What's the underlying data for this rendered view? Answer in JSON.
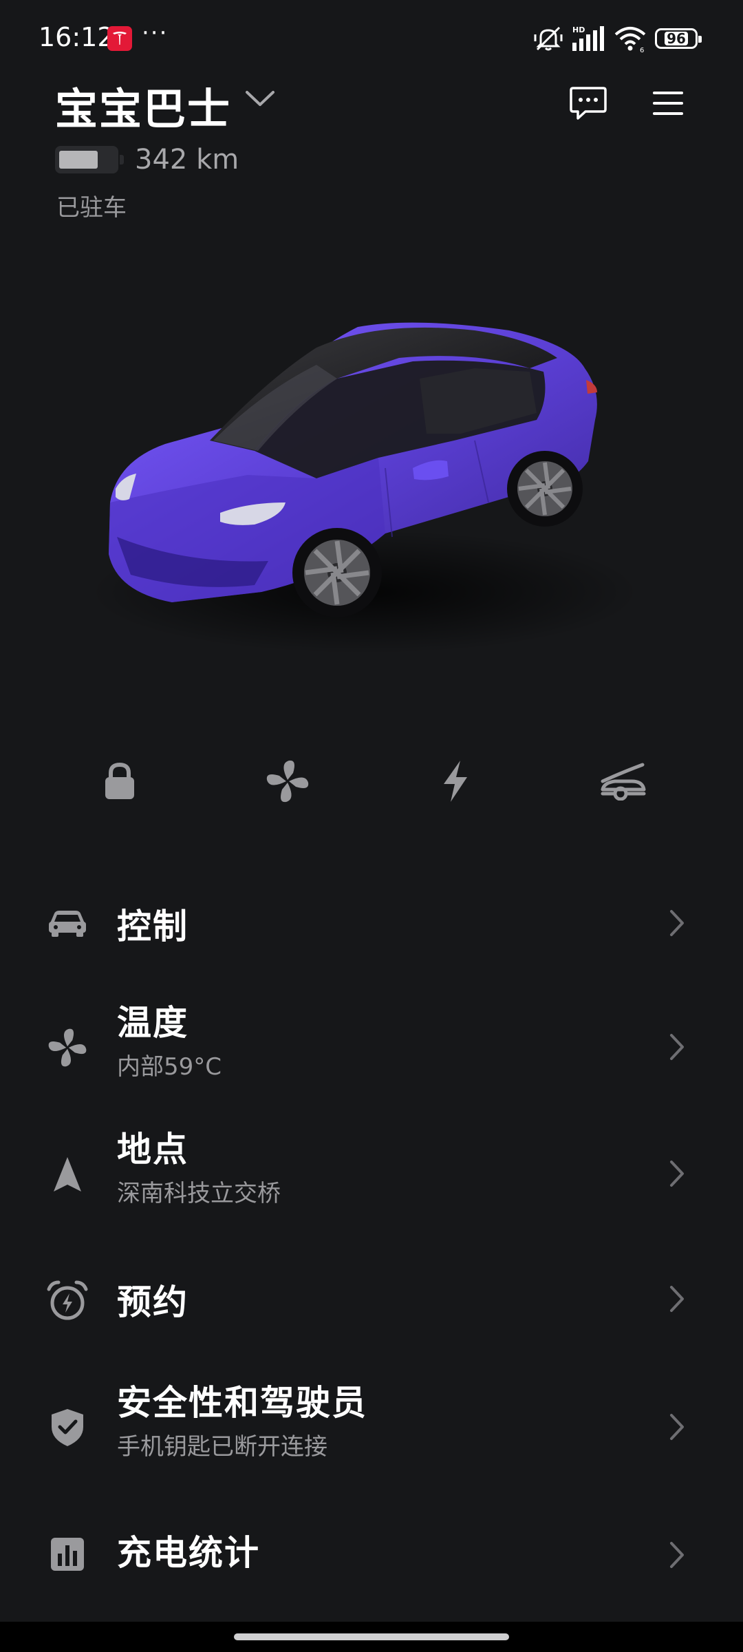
{
  "status_bar": {
    "time": "16:12",
    "app_icon": "tesla-logo-icon",
    "overflow": "···",
    "icons": [
      "mute-vibrate-icon",
      "hd-signal-icon",
      "wifi-icon"
    ],
    "battery_percent": "96"
  },
  "header": {
    "vehicle_name": "宝宝巴士",
    "range": "342 km",
    "battery_level": 0.7,
    "status": "已驻车",
    "actions": [
      "message-icon",
      "menu-icon"
    ]
  },
  "vehicle": {
    "paint_color": "#5b3fd4"
  },
  "quick_actions": [
    "lock-icon",
    "fan-icon",
    "charge-icon",
    "frunk-icon"
  ],
  "menu": [
    {
      "title": "控制",
      "subtitle": "",
      "icon": "car-icon"
    },
    {
      "title": "温度",
      "subtitle": "内部59°C",
      "icon": "fan-icon"
    },
    {
      "title": "地点",
      "subtitle": "深南科技立交桥",
      "icon": "location-arrow-icon"
    },
    {
      "title": "预约",
      "subtitle": "",
      "icon": "alarm-clock-icon"
    },
    {
      "title": "安全性和驾驶员",
      "subtitle": "手机钥匙已断开连接",
      "icon": "shield-check-icon"
    },
    {
      "title": "充电统计",
      "subtitle": "",
      "icon": "bar-chart-icon"
    }
  ],
  "colors": {
    "background": "#161719",
    "primary_text": "#ffffff",
    "secondary_text": "#9a9a9d",
    "icon_gray": "#9a9a9d",
    "tesla_red": "#e31937"
  }
}
